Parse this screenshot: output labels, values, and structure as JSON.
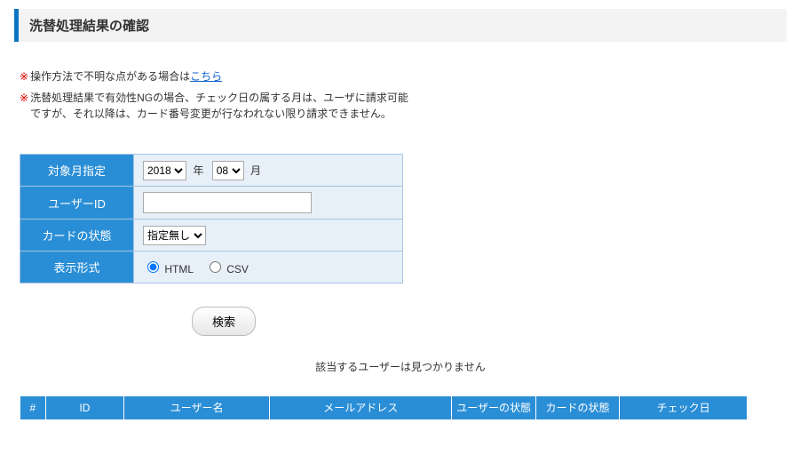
{
  "title": "洗替処理結果の確認",
  "notes": {
    "n1_prefix": "操作方法で不明な点がある場合は",
    "n1_link": "こちら",
    "n2": "洗替処理結果で有効性NGの場合、チェック日の属する月は、ユーザに請求可能ですが、それ以降は、カード番号変更が行なわれない限り請求できません。"
  },
  "form": {
    "month_label": "対象月指定",
    "year_options": [
      "2018"
    ],
    "year_selected": "2018",
    "year_unit": "年",
    "month_options": [
      "08"
    ],
    "month_selected": "08",
    "month_unit": "月",
    "userid_label": "ユーザーID",
    "userid_value": "",
    "card_label": "カードの状態",
    "card_options": [
      "指定無し"
    ],
    "card_selected": "指定無し",
    "format_label": "表示形式",
    "format_html": "HTML",
    "format_csv": "CSV"
  },
  "search_button": "検索",
  "empty_message": "該当するユーザーは見つかりません",
  "results_headers": {
    "num": "#",
    "id": "ID",
    "username": "ユーザー名",
    "email": "メールアドレス",
    "user_status": "ユーザーの状態",
    "card_status": "カードの状態",
    "check_date": "チェック日"
  }
}
